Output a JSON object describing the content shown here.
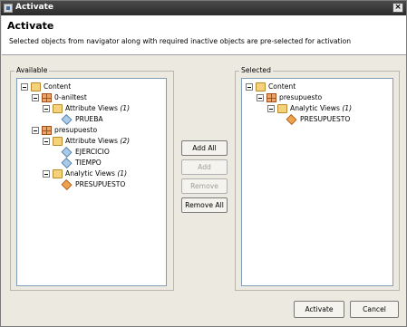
{
  "window": {
    "title": "Activate",
    "close_label": "×"
  },
  "header": {
    "title": "Activate",
    "message": "Selected objects from navigator along with required inactive objects are pre-selected for activation"
  },
  "available": {
    "legend": "Available",
    "nodes": [
      {
        "label": "Content",
        "icon": "folder-icon"
      },
      {
        "label": "0-aniltest",
        "icon": "package-icon"
      },
      {
        "label": "Attribute Views",
        "count": "(1)",
        "icon": "folder-icon"
      },
      {
        "label": "PRUEBA",
        "icon": "attribute-view-icon"
      },
      {
        "label": "presupuesto",
        "icon": "package-icon"
      },
      {
        "label": "Attribute Views",
        "count": "(2)",
        "icon": "folder-icon"
      },
      {
        "label": "EJERCICIO",
        "icon": "attribute-view-icon"
      },
      {
        "label": "TIEMPO",
        "icon": "attribute-view-icon"
      },
      {
        "label": "Analytic Views",
        "count": "(1)",
        "icon": "folder-icon"
      },
      {
        "label": "PRESUPUESTO",
        "icon": "analytic-view-icon"
      }
    ]
  },
  "selected": {
    "legend": "Selected",
    "nodes": [
      {
        "label": "Content",
        "icon": "folder-icon"
      },
      {
        "label": "presupuesto",
        "icon": "package-icon"
      },
      {
        "label": "Analytic Views",
        "count": "(1)",
        "icon": "folder-icon"
      },
      {
        "label": "PRESUPUESTO",
        "icon": "analytic-view-icon"
      }
    ]
  },
  "transfer_buttons": {
    "add_all": "Add All",
    "add": "Add",
    "remove": "Remove",
    "remove_all": "Remove All"
  },
  "footer": {
    "activate": "Activate",
    "cancel": "Cancel"
  }
}
